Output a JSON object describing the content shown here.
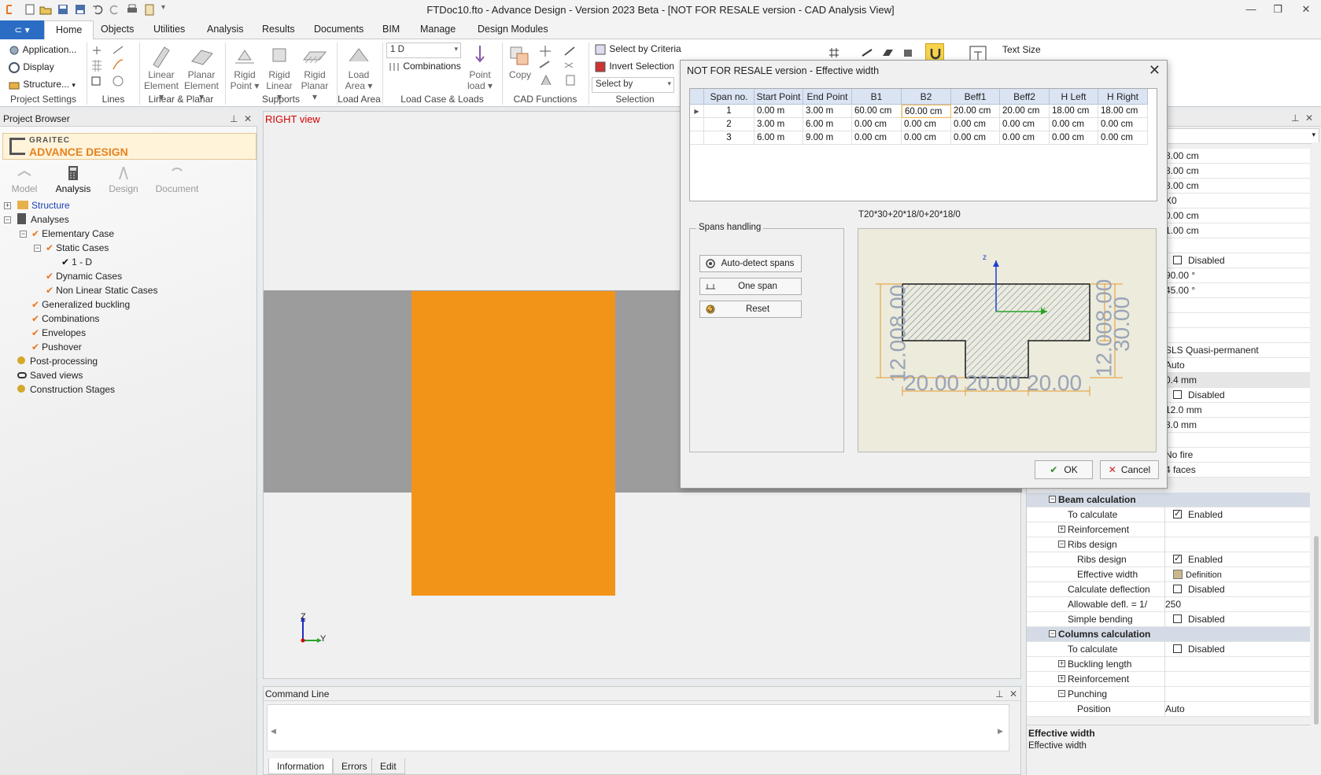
{
  "window": {
    "title": "FTDoc10.fto - Advance Design - Version 2023 Beta - [NOT FOR RESALE version - CAD Analysis View]"
  },
  "ribbon": {
    "tabs": [
      "Home",
      "Objects",
      "Utilities",
      "Analysis",
      "Results",
      "Documents",
      "BIM",
      "Manage",
      "Design Modules"
    ],
    "active_tab": "Home",
    "project_settings": {
      "label": "Project Settings",
      "items": [
        "Application...",
        "Display",
        "Structure..."
      ]
    },
    "lines": {
      "label": "Lines"
    },
    "linear_planar": {
      "label": "Linear & Planar",
      "linear_element": "Linear Element",
      "planar_element": "Planar Element"
    },
    "supports": {
      "label": "Supports",
      "rigid_point": "Rigid Point",
      "rigid_linear": "Rigid Linear",
      "rigid_planar": "Rigid Planar"
    },
    "load_area": {
      "label": "Load Area",
      "btn": "Load Area"
    },
    "loadcase": {
      "label": "Load Case & Loads",
      "combo_value": "1 D",
      "combinations": "Combinations",
      "point_load": "Point load"
    },
    "cad": {
      "label": "CAD Functions",
      "copy": "Copy"
    },
    "selection": {
      "label": "Selection",
      "select_by_criteria": "Select by Criteria",
      "invert_selection": "Invert Selection",
      "select_by": "Select by"
    },
    "text_size": "Text Size"
  },
  "project_browser": {
    "title": "Project Browser",
    "brand_top": "GRAITEC",
    "brand_name": "ADVANCE DESIGN",
    "modes": [
      "Model",
      "Analysis",
      "Design",
      "Document"
    ],
    "active_mode": "Analysis",
    "tree": [
      {
        "label": "Structure",
        "level": 0
      },
      {
        "label": "Analyses",
        "level": 0
      },
      {
        "label": "Elementary Case",
        "level": 1
      },
      {
        "label": "Static Cases",
        "level": 2
      },
      {
        "label": "1 - D",
        "level": 3
      },
      {
        "label": "Dynamic Cases",
        "level": 2
      },
      {
        "label": "Non Linear Static Cases",
        "level": 2
      },
      {
        "label": "Generalized buckling",
        "level": 1
      },
      {
        "label": "Combinations",
        "level": 1
      },
      {
        "label": "Envelopes",
        "level": 1
      },
      {
        "label": "Pushover",
        "level": 1
      },
      {
        "label": "Post-processing",
        "level": 0
      },
      {
        "label": "Saved views",
        "level": 0
      },
      {
        "label": "Construction Stages",
        "level": 0
      }
    ]
  },
  "viewport": {
    "view_label": "RIGHT view",
    "axis_z": "Z",
    "axis_y": "Y",
    "colors": {
      "beam": "#f29418",
      "band": "#9c9c9c",
      "background": "#f0f0f0"
    }
  },
  "command_line": {
    "title": "Command Line",
    "tabs": [
      "Information",
      "Errors",
      "Edit"
    ],
    "active_tab": "Information"
  },
  "dialog": {
    "title": "NOT FOR RESALE version - Effective width",
    "columns": [
      "Span no.",
      "Start Point",
      "End Point",
      "B1",
      "B2",
      "Beff1",
      "Beff2",
      "H Left",
      "H Right"
    ],
    "rows": [
      [
        "1",
        "0.00 m",
        "3.00 m",
        "60.00 cm",
        "60.00 cm",
        "20.00 cm",
        "20.00 cm",
        "18.00 cm",
        "18.00 cm"
      ],
      [
        "2",
        "3.00 m",
        "6.00 m",
        "0.00 cm",
        "0.00 cm",
        "0.00 cm",
        "0.00 cm",
        "0.00 cm",
        "0.00 cm"
      ],
      [
        "3",
        "6.00 m",
        "9.00 m",
        "0.00 cm",
        "0.00 cm",
        "0.00 cm",
        "0.00 cm",
        "0.00 cm",
        "0.00 cm"
      ]
    ],
    "section_label": "T20*30+20*18/0+20*18/0",
    "spans_handling": "Spans handling",
    "btn_autodetect": "Auto-detect spans",
    "btn_one_span": "One span",
    "btn_reset": "Reset",
    "btn_ok": "OK",
    "btn_cancel": "Cancel",
    "preview": {
      "dim_left": "12.008.00",
      "dim_right_a": "12.008.00",
      "dim_right_b": "30.00",
      "dim_b1": "20.00",
      "dim_b2": "20.00",
      "dim_b3": "20.00",
      "axis_z": "z",
      "axis_y": "y"
    }
  },
  "properties": {
    "top_values": [
      "3.00 cm",
      "3.00 cm",
      "3.00 cm",
      "X0",
      "0.00 cm",
      "1.00 cm"
    ],
    "disabled_1": "Disabled",
    "angle_1": "90.00 °",
    "angle_2": "45.00 °",
    "sls": "SLS Quasi-permanent",
    "auto": "Auto",
    "mm_04": "0.4 mm",
    "disabled_2": "Disabled",
    "mm_12": "12.0 mm",
    "mm_3": "3.0 mm",
    "no_fire": "No fire",
    "faces": "4 faces",
    "beam_calc": "Beam calculation",
    "to_calculate": "To calculate",
    "enabled": "Enabled",
    "reinforcement": "Reinforcement",
    "ribs_design_group": "Ribs design",
    "ribs_design": "Ribs design",
    "effective_width": "Effective width",
    "definition": "Definition",
    "calc_deflection": "Calculate deflection",
    "disabled": "Disabled",
    "allowable_defl": "Allowable defl. = 1/",
    "allowable_val": "250",
    "simple_bending": "Simple bending",
    "columns_calc": "Columns calculation",
    "buckling_length": "Buckling length",
    "punching": "Punching",
    "position": "Position",
    "desc_title": "Effective width",
    "desc_text": "Effective width"
  }
}
